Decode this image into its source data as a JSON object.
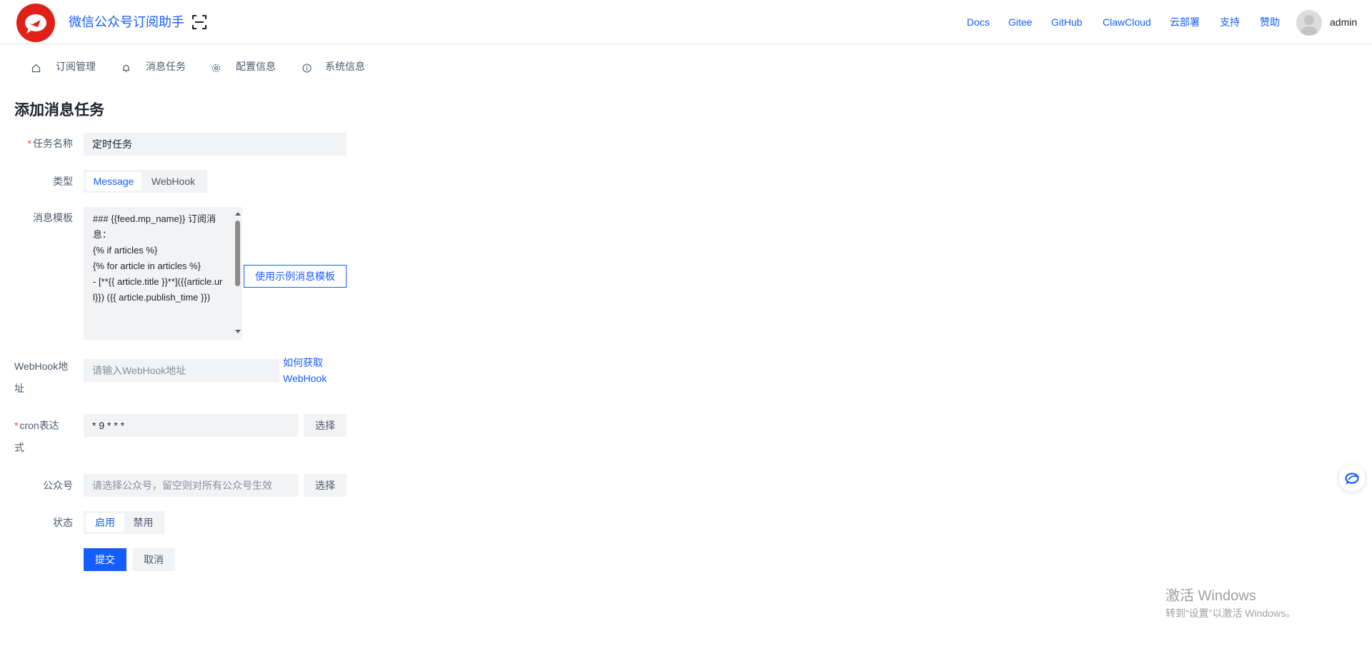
{
  "header": {
    "app_title": "微信公众号订阅助手",
    "nav": [
      "Docs",
      "Gitee",
      "GitHub",
      "ClawCloud",
      "云部署",
      "支持",
      "赞助"
    ],
    "username": "admin"
  },
  "subnav": [
    {
      "label": "订阅管理",
      "icon": "home-icon"
    },
    {
      "label": "消息任务",
      "icon": "bell-icon"
    },
    {
      "label": "配置信息",
      "icon": "gear-icon"
    },
    {
      "label": "系统信息",
      "icon": "info-icon"
    }
  ],
  "form": {
    "page_title": "添加消息任务",
    "required_mark": "*",
    "task_name": {
      "label": "任务名称",
      "value": "定时任务"
    },
    "type": {
      "label": "类型",
      "options": [
        "Message",
        "WebHook"
      ],
      "selected": "Message"
    },
    "template": {
      "label": "消息模板",
      "value": "### {{feed.mp_name}} 订阅消息：\n{% if articles %}\n{% for article in articles %}\n- [**{{ article.title }}**]({{article.url}}) ({{ article.publish_time }})",
      "example_button": "使用示例消息模板"
    },
    "webhook": {
      "label_line1": "WebHook地",
      "label_line2": "址",
      "placeholder": "请输入WebHook地址",
      "help_line1": "如何获取",
      "help_line2": "WebHook"
    },
    "cron": {
      "label_line1": "cron表达",
      "label_line2": "式",
      "value": "* 9 * * *",
      "select_button": "选择"
    },
    "account": {
      "label": "公众号",
      "placeholder": "请选择公众号，留空则对所有公众号生效",
      "select_button": "选择"
    },
    "status": {
      "label": "状态",
      "options": [
        "启用",
        "禁用"
      ],
      "selected": "启用"
    },
    "submit": "提交",
    "cancel": "取消"
  },
  "watermark": {
    "title": "激活 Windows",
    "subtitle": "转到“设置”以激活 Windows。"
  },
  "colors": {
    "primary": "#165dff",
    "logo_red": "#e0211a",
    "required": "#f53f3f",
    "input_bg": "#f2f3f5"
  }
}
